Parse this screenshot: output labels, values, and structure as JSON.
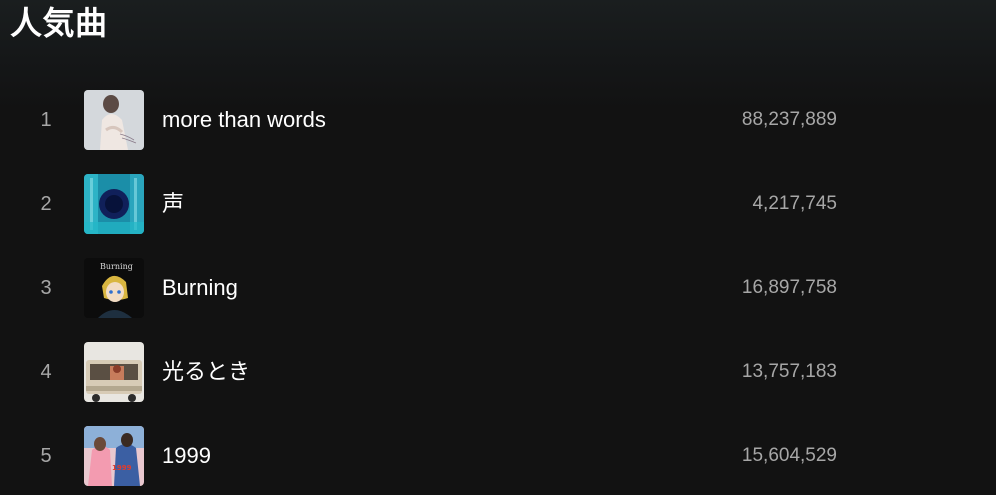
{
  "section": {
    "title": "人気曲"
  },
  "tracks": [
    {
      "rank": "1",
      "title": "more than words",
      "plays": "88,237,889",
      "cover_colors": [
        "#c9ccd0",
        "#e8e4e2"
      ]
    },
    {
      "rank": "2",
      "title": "声",
      "plays": "4,217,745",
      "cover_colors": [
        "#1fa3b8",
        "#0a2f5c"
      ]
    },
    {
      "rank": "3",
      "title": "Burning",
      "plays": "16,897,758",
      "cover_colors": [
        "#0e0e0e",
        "#d9b640"
      ]
    },
    {
      "rank": "4",
      "title": "光るとき",
      "plays": "13,757,183",
      "cover_colors": [
        "#e7e4de",
        "#8b6b4a"
      ]
    },
    {
      "rank": "5",
      "title": "1999",
      "plays": "15,604,529",
      "cover_colors": [
        "#f2a6b7",
        "#3a5a9e"
      ]
    }
  ],
  "cover_text": {
    "track3": "Burning",
    "track5": "1999"
  }
}
